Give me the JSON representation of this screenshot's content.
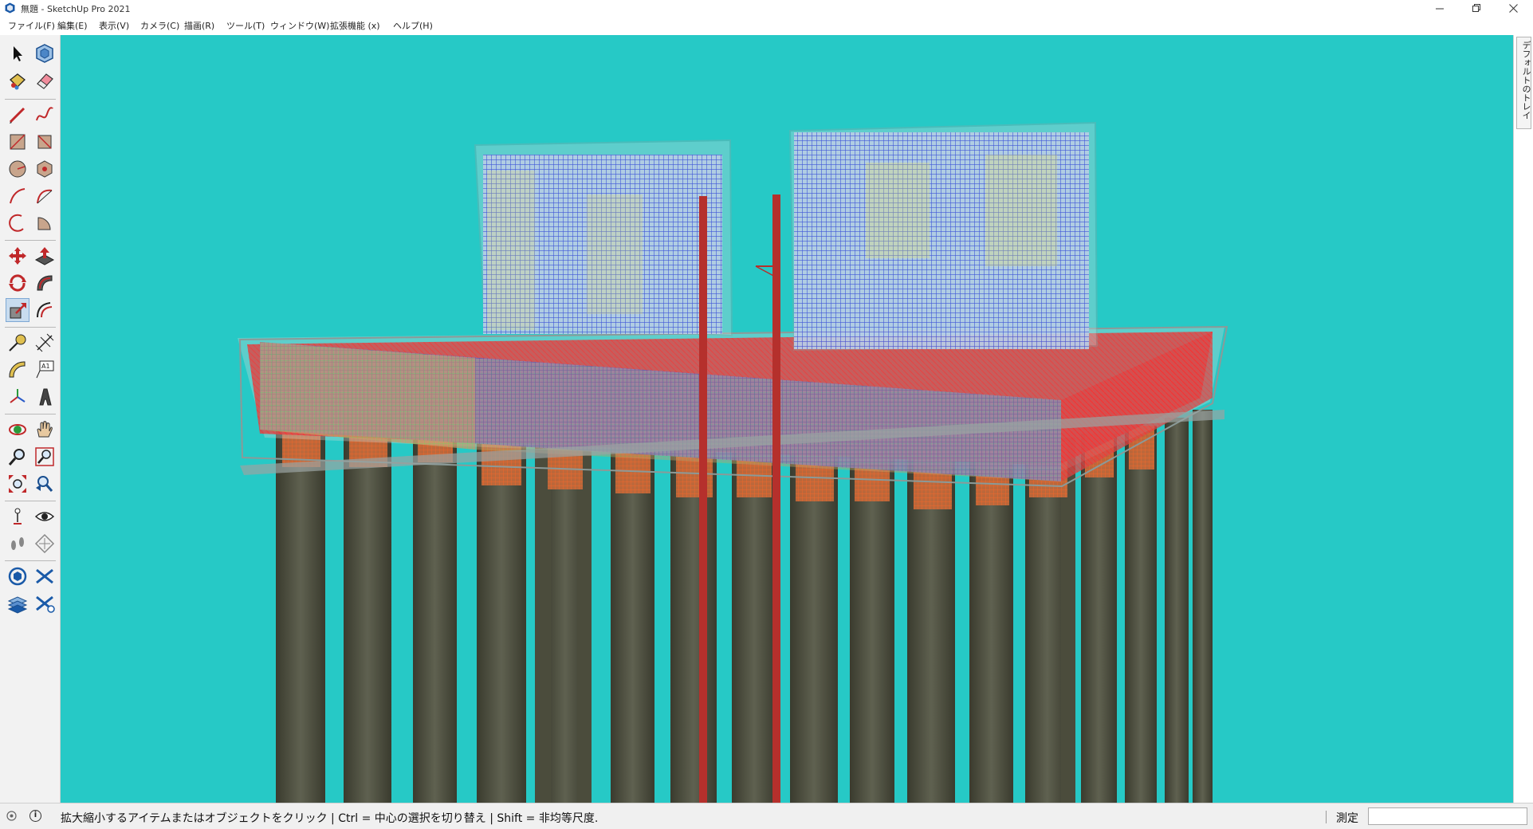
{
  "window": {
    "title": "無題 - SketchUp Pro 2021",
    "controls": {
      "minimize_icon": "minimize-icon",
      "restore_icon": "restore-icon",
      "close_icon": "close-icon"
    }
  },
  "menu": [
    "ファイル(F)",
    "編集(E)",
    "表示(V)",
    "カメラ(C)",
    "描画(R)",
    "ツール(T)",
    "ウィンドウ(W)",
    "拡張機能 (x)",
    "ヘルプ(H)"
  ],
  "toolbar": {
    "active_tool": "scale-tool",
    "tools": [
      "select-tool",
      "component-tool",
      "paint-bucket-tool",
      "eraser-tool",
      "line-tool",
      "freehand-tool",
      "rectangle-tool",
      "rotated-rectangle-tool",
      "circle-tool",
      "polygon-tool",
      "arc-tool",
      "two-point-arc-tool",
      "three-point-arc-tool",
      "pie-tool",
      "move-tool",
      "push-pull-tool",
      "rotate-tool",
      "follow-me-tool",
      "scale-tool",
      "offset-tool",
      "tape-measure-tool",
      "dimension-tool",
      "protractor-tool",
      "text-tool",
      "axes-tool",
      "3d-text-tool",
      "orbit-tool",
      "pan-tool",
      "zoom-tool",
      "zoom-window-tool",
      "zoom-extents-tool",
      "previous-view-tool",
      "position-camera-tool",
      "look-around-tool",
      "walk-tool",
      "section-plane-tool",
      "warehouse-tool",
      "extension-warehouse-tool",
      "layout-tool",
      "extension-manager-tool"
    ]
  },
  "viewport": {
    "background": "#26c9c6"
  },
  "tray": {
    "label": "デフォルトのトレイ"
  },
  "status": {
    "message": "拡大縮小するアイテムまたはオブジェクトをクリック | Ctrl = 中心の選択を切り替え | Shift = 非均等尺度.",
    "measure_label": "測定",
    "measure_value": ""
  }
}
